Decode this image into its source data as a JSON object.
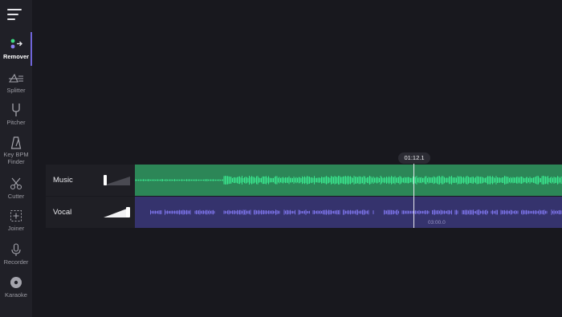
{
  "sidebar": {
    "menu_icon": "hamburger-menu-icon",
    "items": [
      {
        "id": "remover",
        "label": "Remover",
        "icon": "remover-icon",
        "active": true
      },
      {
        "id": "splitter",
        "label": "Splitter",
        "icon": "splitter-icon"
      },
      {
        "id": "pitcher",
        "label": "Pitcher",
        "icon": "tuning-fork-icon"
      },
      {
        "id": "key-bpm",
        "label": "Key BPM Finder",
        "label_lines": [
          "Key BPM",
          "Finder"
        ],
        "icon": "metronome-icon"
      },
      {
        "id": "cutter",
        "label": "Cutter",
        "icon": "scissors-icon"
      },
      {
        "id": "joiner",
        "label": "Joiner",
        "icon": "joiner-icon"
      },
      {
        "id": "recorder",
        "label": "Recorder",
        "icon": "microphone-icon"
      },
      {
        "id": "karaoke",
        "label": "Karaoke",
        "icon": "disc-icon"
      }
    ]
  },
  "player": {
    "current_time": "01:12.1",
    "playhead_fraction": 0.653,
    "timeline_mark": "03:00.0"
  },
  "tracks": [
    {
      "name": "Music",
      "volume": 0.0,
      "color": "#2c8657",
      "wave_color": "#3ae88f"
    },
    {
      "name": "Vocal",
      "volume": 1.0,
      "color": "#35336d",
      "wave_color": "#7a72e6"
    }
  ],
  "colors": {
    "background": "#18181e",
    "sidebar": "#202027",
    "accent": "#6f64d8"
  }
}
